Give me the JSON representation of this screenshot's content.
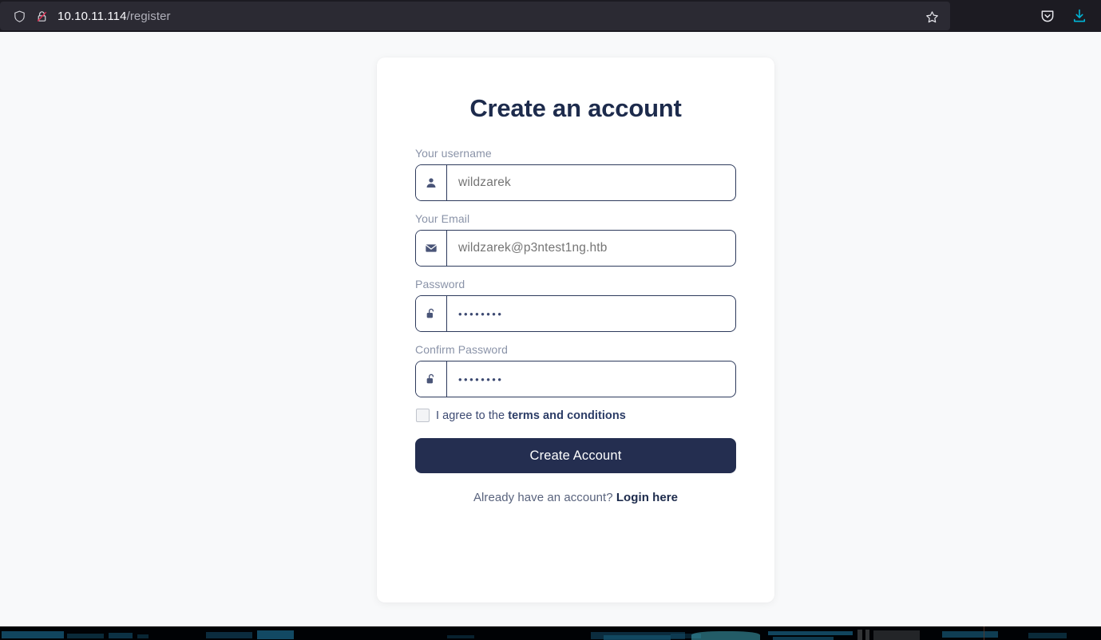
{
  "browser": {
    "shield_icon": "shield-icon",
    "lock_icon": "insecure-lock-icon",
    "url_host": "10.10.11.114",
    "url_path": "/register",
    "star_icon": "bookmark-star-icon",
    "pocket_icon": "pocket-icon",
    "download_icon": "download-icon",
    "accent_download": "#00b6d7",
    "chrome_bg": "#1c1b22",
    "urlbar_bg": "#2b2a33"
  },
  "card": {
    "title": "Create an account",
    "fields": [
      {
        "label": "Your username",
        "icon": "user-icon",
        "value": "",
        "placeholder": "wildzarek",
        "type": "text",
        "name": "username"
      },
      {
        "label": "Your Email",
        "icon": "envelope-icon",
        "value": "",
        "placeholder": "wildzarek@p3ntest1ng.htb",
        "type": "text",
        "name": "email"
      },
      {
        "label": "Password",
        "icon": "unlock-icon",
        "value": "••••••••",
        "placeholder": "",
        "type": "password",
        "name": "password"
      },
      {
        "label": "Confirm Password",
        "icon": "unlock-icon",
        "value": "••••••••",
        "placeholder": "",
        "type": "password",
        "name": "confirm-password"
      }
    ],
    "terms": {
      "checkbox_checked": false,
      "prefix": "I agree to the ",
      "link": "terms and conditions"
    },
    "submit_label": "Create Account",
    "footer": {
      "prefix": "Already have an account? ",
      "link": "Login here"
    },
    "accent_dark": "#242e50",
    "title_color": "#1d2b4c",
    "label_color": "#8a93a8",
    "border_color": "#2d3a5c"
  }
}
